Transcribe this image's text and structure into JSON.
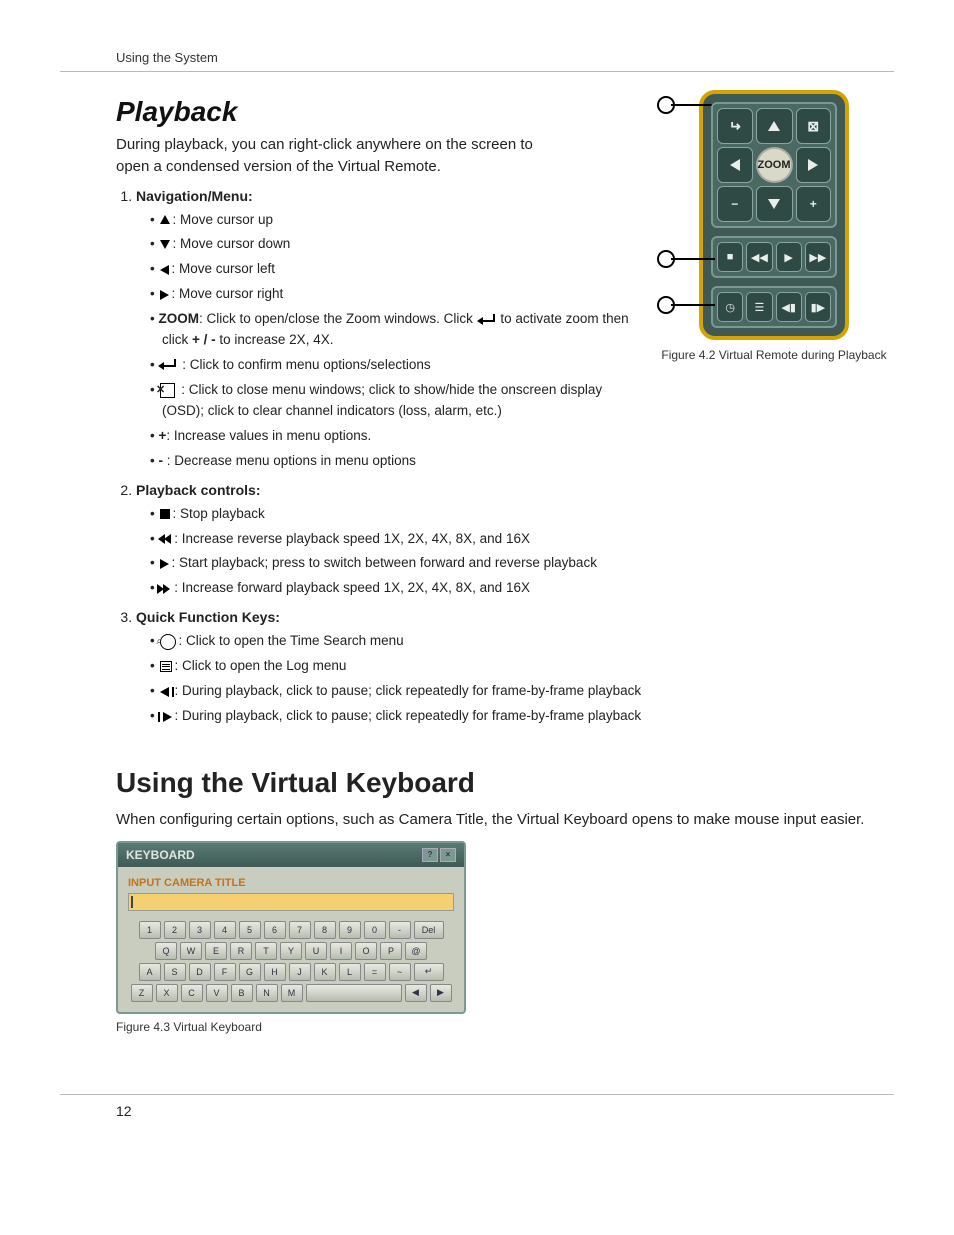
{
  "running_head": "Using the System",
  "page_number": "12",
  "section1": {
    "title": "Playback",
    "intro": "During playback, you can right-click anywhere on the screen to open a condensed version of the Virtual Remote.",
    "fig_caption": "Figure 4.2 Virtual Remote during Playback",
    "list": {
      "item1_head": "Navigation/Menu",
      "nav_up": ": Move cursor up",
      "nav_down": ": Move cursor down",
      "nav_left": ": Move cursor left",
      "nav_right": ": Move cursor right",
      "zoom_label": "ZOOM",
      "zoom_text_a": ": Click to open/close the Zoom windows. Click ",
      "zoom_text_b": " to activate zoom then click ",
      "zoom_pm": "+ / -",
      "zoom_text_c": " to increase 2X, 4X.",
      "enter_text": " : Click to confirm menu options/selections",
      "close_text": " : Click to close menu windows; click to show/hide the onscreen display (OSD); click to clear channel indicators (loss, alarm, etc.)",
      "plus_label": "+",
      "plus_text": ": Increase values in menu options.",
      "minus_label": "-",
      "minus_text": " : Decrease menu options in menu options",
      "item2_head": "Playback controls",
      "pb_stop": ": Stop playback",
      "pb_rew": ": Increase reverse playback speed 1X, 2X, 4X, 8X, and 16X",
      "pb_play": ": Start playback; press to switch between forward and reverse playback",
      "pb_ffw": ": Increase forward playback speed 1X, 2X, 4X, 8X, and 16X",
      "item3_head": "Quick Function Keys",
      "qf_time": ": Click to open the Time Search menu",
      "qf_log": ": Click to open the Log menu",
      "qf_stepb": ": During playback, click to pause; click repeatedly for frame-by-frame playback",
      "qf_stepf": ": During playback, click to pause; click repeatedly for frame-by-frame playback"
    },
    "remote": {
      "zoom_label": "ZOOM"
    }
  },
  "section2": {
    "title": "Using the Virtual Keyboard",
    "intro": "When configuring certain options, such as Camera Title, the Virtual Keyboard opens to make mouse input easier.",
    "fig_caption": "Figure 4.3 Virtual Keyboard",
    "kb_title": "KEYBOARD",
    "kb_label": "INPUT CAMERA TITLE",
    "keys_row1": [
      "1",
      "2",
      "3",
      "4",
      "5",
      "6",
      "7",
      "8",
      "9",
      "0",
      "-",
      "Del"
    ],
    "keys_row2": [
      "Q",
      "W",
      "E",
      "R",
      "T",
      "Y",
      "U",
      "I",
      "O",
      "P",
      "@"
    ],
    "keys_row3": [
      "A",
      "S",
      "D",
      "F",
      "G",
      "H",
      "J",
      "K",
      "L",
      "=",
      "~"
    ],
    "keys_row4": [
      "Z",
      "X",
      "C",
      "V",
      "B",
      "N",
      "M"
    ]
  }
}
